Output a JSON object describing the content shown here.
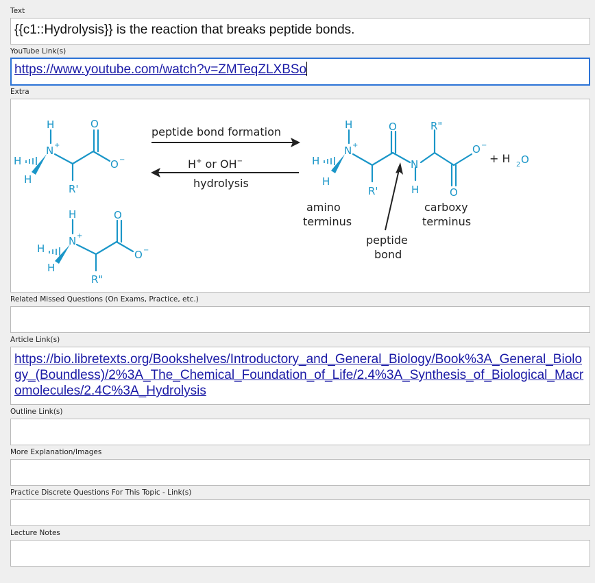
{
  "fields": [
    {
      "id": "text",
      "label": "Text",
      "value": "{{c1::Hydrolysis}} is the reaction that breaks peptide bonds."
    },
    {
      "id": "youtube",
      "label": "YouTube Link(s)",
      "value": "https://www.youtube.com/watch?v=ZMTeqZLXBSo"
    },
    {
      "id": "extra",
      "label": "Extra"
    },
    {
      "id": "related",
      "label": "Related Missed Questions (On Exams, Practice, etc.)",
      "value": ""
    },
    {
      "id": "article",
      "label": "Article Link(s)",
      "value": "https://bio.libretexts.org/Bookshelves/Introductory_and_General_Biology/Book%3A_General_Biology_(Boundless)/2%3A_The_Chemical_Foundation_of_Life/2.4%3A_Synthesis_of_Biological_Macromolecules/2.4C%3A_Hydrolysis"
    },
    {
      "id": "outline",
      "label": "Outline Link(s)",
      "value": ""
    },
    {
      "id": "more",
      "label": "More Explanation/Images",
      "value": ""
    },
    {
      "id": "practice",
      "label": "Practice Discrete Questions For This Topic - Link(s)",
      "value": ""
    },
    {
      "id": "lecture",
      "label": "Lecture Notes",
      "value": ""
    }
  ],
  "diagram": {
    "forward_label": "peptide bond formation",
    "reverse_label_main": "H",
    "reverse_label_plus": "+",
    "reverse_label_or": " or OH",
    "reverse_label_minus": "−",
    "hydrolysis_label": "hydrolysis",
    "amino_terminus": [
      "amino",
      "terminus"
    ],
    "carboxy_terminus": [
      "carboxy",
      "terminus"
    ],
    "peptide_bond": [
      "peptide",
      "bond"
    ],
    "water": "+ H",
    "water_sub": "2",
    "water_O": "O",
    "r_group_1": "R'",
    "r_group_2": "R\"",
    "atoms": {
      "H": "H",
      "N": "N",
      "O": "O",
      "O_minus": "O",
      "charge_plus": "+",
      "charge_minus": "−"
    }
  },
  "colors": {
    "chem": "#1a96c8",
    "focus": "#2b73d6",
    "link": "#1a1aa6"
  }
}
